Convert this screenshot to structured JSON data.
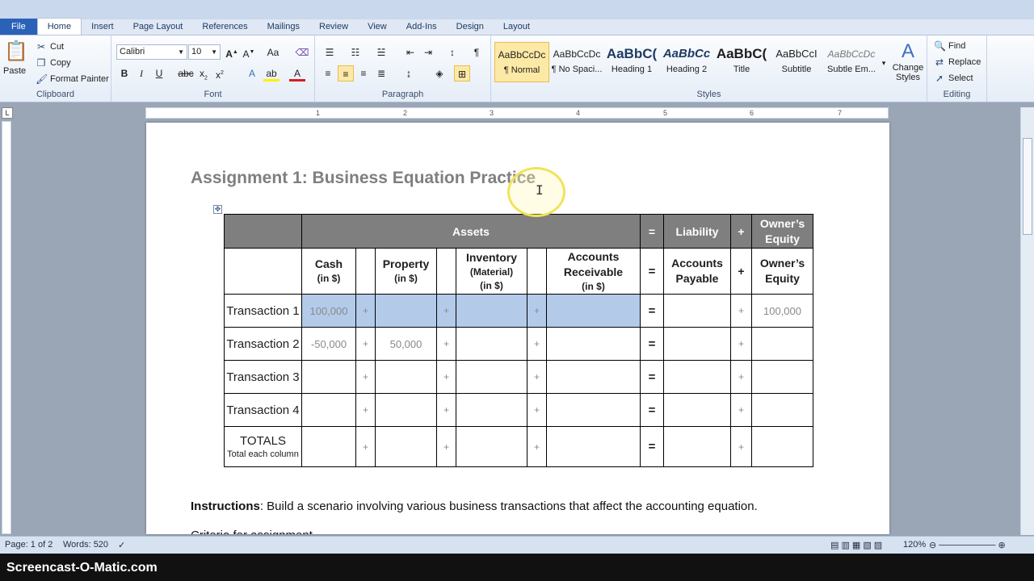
{
  "tabs": [
    "File",
    "Home",
    "Insert",
    "Page Layout",
    "References",
    "Mailings",
    "Review",
    "View",
    "Add-Ins",
    "Design",
    "Layout"
  ],
  "ribbon": {
    "clipboard": {
      "paste": "Paste",
      "cut": "Cut",
      "copy": "Copy",
      "format_painter": "Format Painter",
      "label": "Clipboard"
    },
    "font": {
      "name": "Calibri",
      "size": "10",
      "label": "Font"
    },
    "paragraph": {
      "label": "Paragraph"
    },
    "styles": {
      "items": [
        {
          "sample": "AaBbCcDc",
          "name": "¶ Normal"
        },
        {
          "sample": "AaBbCcDc",
          "name": "¶ No Spaci..."
        },
        {
          "sample": "AaBbC(",
          "name": "Heading 1"
        },
        {
          "sample": "AaBbCc",
          "name": "Heading 2"
        },
        {
          "sample": "AaBbC(",
          "name": "Title"
        },
        {
          "sample": "AaBbCcI",
          "name": "Subtitle"
        },
        {
          "sample": "AaBbCcDc",
          "name": "Subtle Em..."
        }
      ],
      "change_styles": "Change Styles",
      "label": "Styles"
    },
    "editing": {
      "find": "Find",
      "replace": "Replace",
      "select": "Select",
      "label": "Editing"
    }
  },
  "ruler_numbers": [
    "1",
    "2",
    "3",
    "4",
    "5",
    "6",
    "7"
  ],
  "document": {
    "title": "Assignment 1: Business Equation Practice",
    "table": {
      "hdr1": {
        "assets": "Assets",
        "eq": "=",
        "liability": "Liability",
        "plus": "+",
        "equity": "Owner’s Equity"
      },
      "hdr2": {
        "cash": "Cash",
        "cash_sub": "(in $)",
        "property": "Property",
        "property_sub": "(in $)",
        "inventory": "Inventory",
        "inventory_mat": "(Material)",
        "inventory_sub": "(in $)",
        "ar": "Accounts Receivable",
        "ar_sub": "(in $)",
        "eq": "=",
        "ap": "Accounts Payable",
        "plus": "+",
        "oe": "Owner’s Equity"
      },
      "rows": [
        {
          "label": "Transaction 1",
          "cash": "100,000",
          "property": "",
          "equity": "100,000"
        },
        {
          "label": "Transaction 2",
          "cash": "-50,000",
          "property": "50,000",
          "equity": ""
        },
        {
          "label": "Transaction 3",
          "cash": "",
          "property": "",
          "equity": ""
        },
        {
          "label": "Transaction 4",
          "cash": "",
          "property": "",
          "equity": ""
        }
      ],
      "totals": {
        "label": "TOTALS",
        "sub": "Total each column"
      },
      "plus": "+",
      "eq": "="
    },
    "instructions_label": "Instructions",
    "instructions_text": ": Build a scenario involving various business transactions that affect the accounting equation.",
    "cutoff_text": "Criteria for assignment"
  },
  "status": {
    "page": "Page: 1 of 2",
    "words": "Words: 520",
    "zoom": "120%"
  },
  "watermark": "Screencast-O-Matic.com"
}
